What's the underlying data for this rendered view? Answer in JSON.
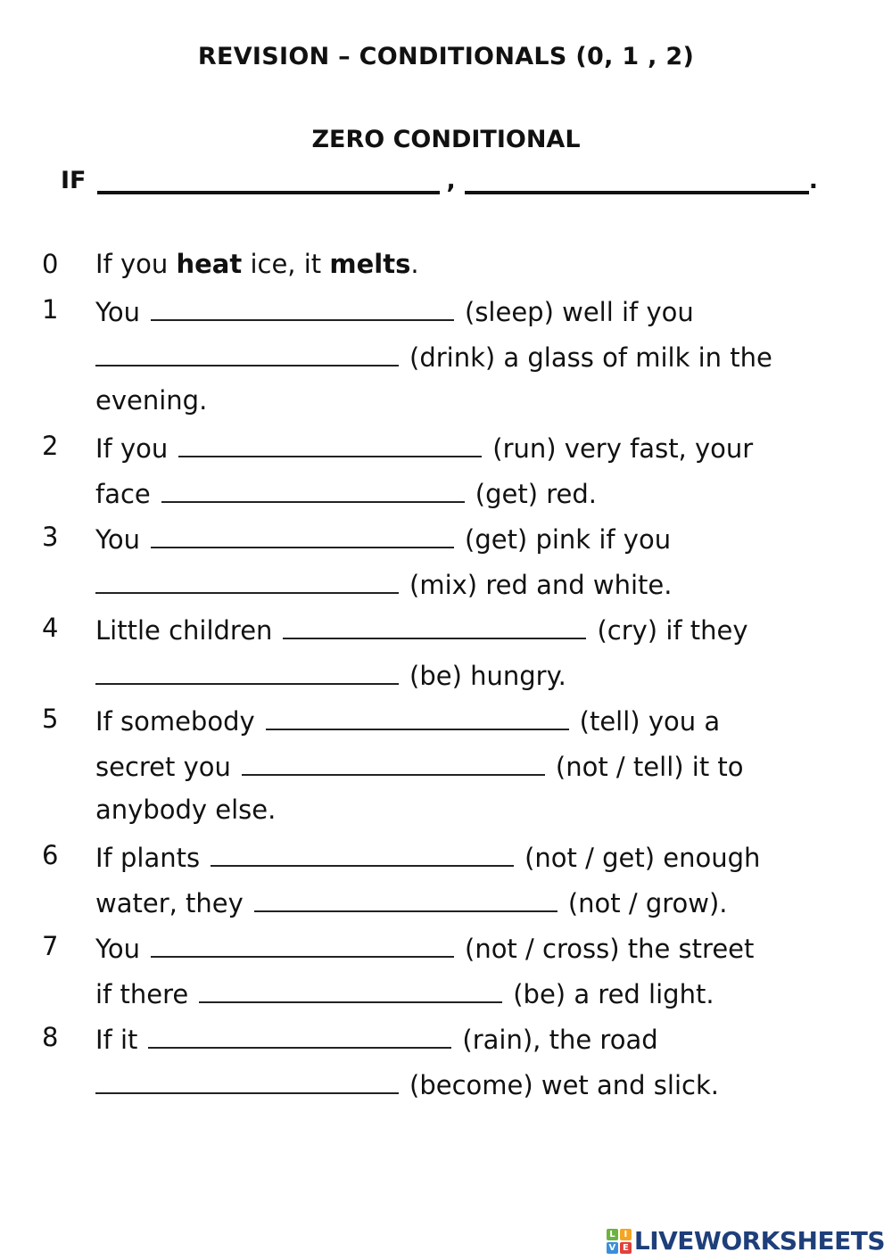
{
  "title": "REVISION – CONDITIONALS (0, 1 , 2)",
  "section": {
    "heading": "ZERO CONDITIONAL",
    "formula": {
      "if": "IF",
      "comma": ",",
      "end": "."
    }
  },
  "example": {
    "number": "0",
    "parts": [
      "If you ",
      "heat",
      " ice, it ",
      "melts",
      "."
    ]
  },
  "exercises": [
    {
      "number": "1",
      "lines": [
        {
          "before": "You",
          "after": "(sleep) well if you"
        },
        {
          "before": "",
          "after": "(drink) a glass of milk in the"
        },
        {
          "text": "evening."
        }
      ]
    },
    {
      "number": "2",
      "lines": [
        {
          "before": "If you",
          "after": "(run) very fast, your"
        },
        {
          "before": "face",
          "after": "(get) red."
        }
      ]
    },
    {
      "number": "3",
      "lines": [
        {
          "before": "You",
          "after": "(get) pink if you"
        },
        {
          "before": "",
          "after": "(mix) red and white."
        }
      ]
    },
    {
      "number": "4",
      "lines": [
        {
          "before": "Little children",
          "after": "(cry) if they"
        },
        {
          "before": "",
          "after": "(be) hungry."
        }
      ]
    },
    {
      "number": "5",
      "lines": [
        {
          "before": "If somebody",
          "after": "(tell) you a"
        },
        {
          "before": "secret you",
          "after": "(not / tell) it to"
        },
        {
          "text": "anybody else."
        }
      ]
    },
    {
      "number": "6",
      "lines": [
        {
          "before": "If plants",
          "after": "(not / get) enough"
        },
        {
          "before": "water, they",
          "after": "(not / grow)."
        }
      ]
    },
    {
      "number": "7",
      "lines": [
        {
          "before": "You",
          "after": "(not / cross) the street"
        },
        {
          "before": "if there",
          "after": "(be) a red light."
        }
      ]
    },
    {
      "number": "8",
      "lines": [
        {
          "before": "If it",
          "after": "(rain), the road"
        },
        {
          "before": "",
          "after": "(become) wet and slick."
        }
      ]
    }
  ],
  "branding": {
    "logo_letters": [
      "L",
      "I",
      "V",
      "E"
    ],
    "logo_colors": [
      "#6cb33f",
      "#f4a623",
      "#3b8fd9",
      "#e2403a"
    ],
    "logo_text": "LIVEWORKSHEETS",
    "logo_text_color": "#1e3f7a"
  }
}
